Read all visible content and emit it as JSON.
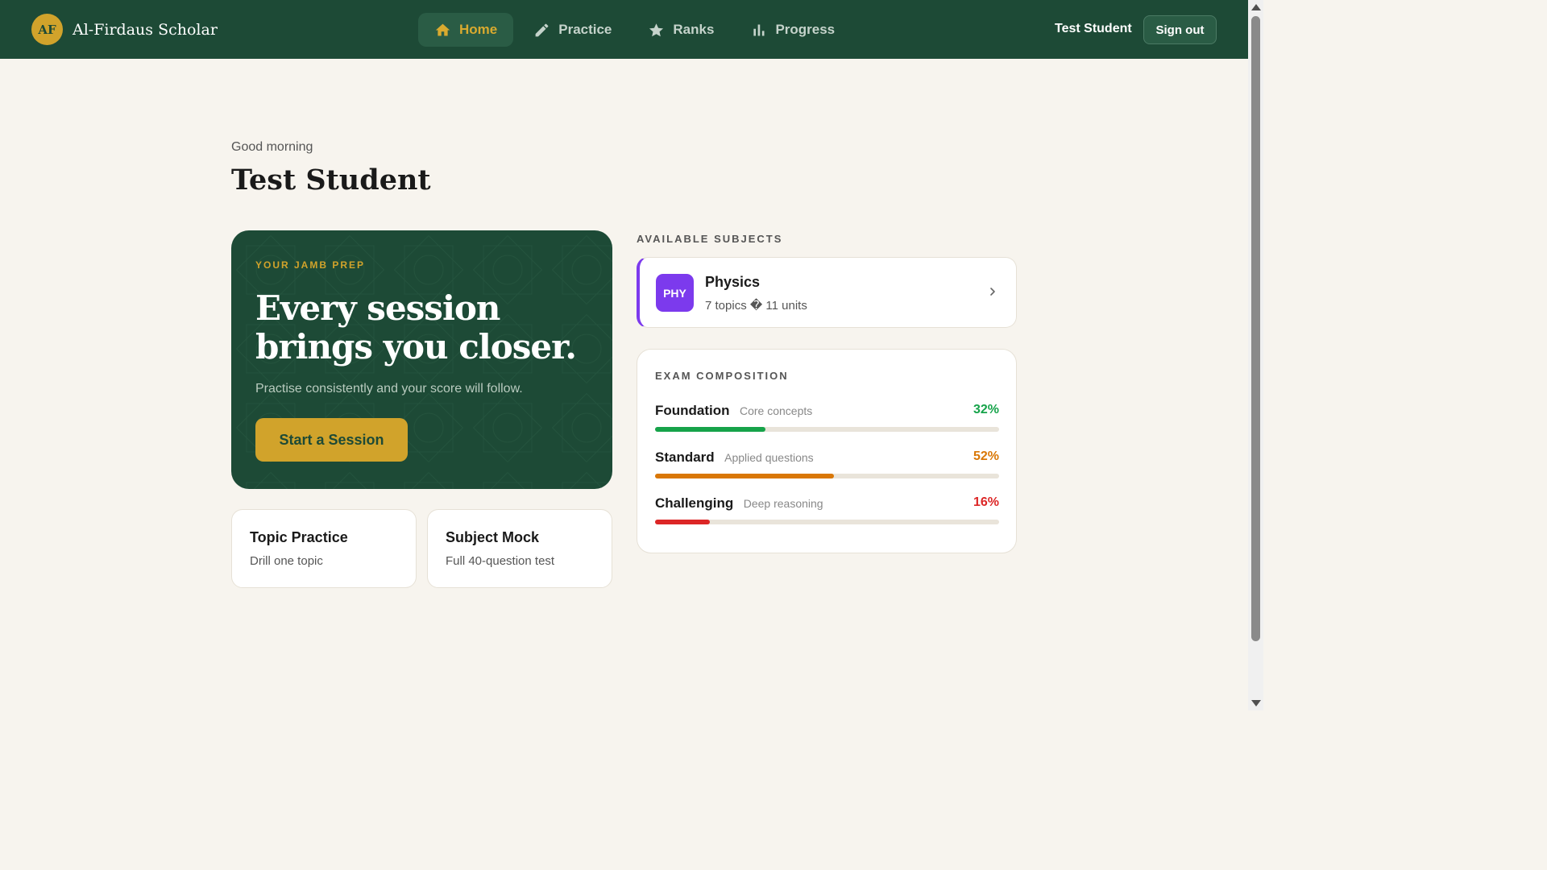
{
  "brand": {
    "initials": "AF",
    "name": "Al-Firdaus Scholar"
  },
  "nav": {
    "items": [
      {
        "label": "Home",
        "icon": "home-icon",
        "active": true
      },
      {
        "label": "Practice",
        "icon": "pencil-icon",
        "active": false
      },
      {
        "label": "Ranks",
        "icon": "star-icon",
        "active": false
      },
      {
        "label": "Progress",
        "icon": "bar-chart-icon",
        "active": false
      }
    ],
    "user_name": "Test Student",
    "signout_label": "Sign out"
  },
  "greeting": {
    "salutation": "Good morning",
    "name": "Test Student"
  },
  "hero": {
    "eyebrow": "YOUR JAMB PREP",
    "heading": "Every session brings you closer.",
    "subtext": "Practise consistently and your score will follow.",
    "button_label": "Start a Session"
  },
  "quick_cards": [
    {
      "title": "Topic Practice",
      "subtitle": "Drill one topic"
    },
    {
      "title": "Subject Mock",
      "subtitle": "Full 40-question test"
    }
  ],
  "subjects": {
    "section_label": "AVAILABLE SUBJECTS",
    "items": [
      {
        "badge": "PHY",
        "name": "Physics",
        "meta": "7 topics � 11 units",
        "color": "#7c3aed"
      }
    ]
  },
  "exam_composition": {
    "title": "EXAM COMPOSITION",
    "levels": [
      {
        "name": "Foundation",
        "desc": "Core concepts",
        "pct_label": "32%",
        "value": 32,
        "color": "#16a34a"
      },
      {
        "name": "Standard",
        "desc": "Applied questions",
        "pct_label": "52%",
        "value": 52,
        "color": "#d97706"
      },
      {
        "name": "Challenging",
        "desc": "Deep reasoning",
        "pct_label": "16%",
        "value": 16,
        "color": "#dc2626"
      }
    ]
  },
  "colors": {
    "primary": "#1d4a36",
    "accent": "#d1a32b",
    "background": "#f7f4ee"
  }
}
